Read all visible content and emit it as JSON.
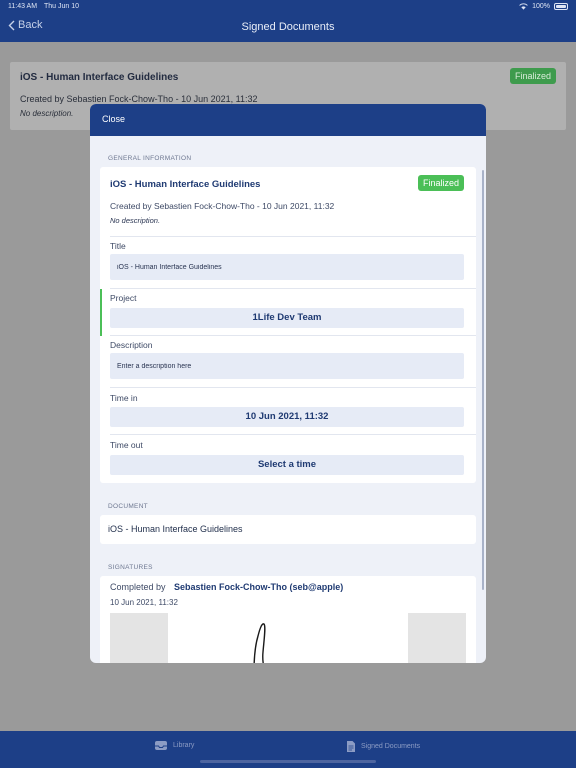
{
  "status_bar": {
    "time": "11:43 AM",
    "date": "Thu Jun 10",
    "battery": "100%"
  },
  "nav": {
    "back_label": "Back",
    "title": "Signed Documents"
  },
  "background_row": {
    "title": "iOS - Human Interface Guidelines",
    "status": "Finalized",
    "meta": "Created by Sebastien Fock-Chow-Tho - 10 Jun 2021, 11:32",
    "description": "No description."
  },
  "modal": {
    "close_label": "Close",
    "general": {
      "section_label": "GENERAL INFORMATION",
      "title": "iOS - Human Interface Guidelines",
      "status": "Finalized",
      "meta": "Created by Sebastien Fock-Chow-Tho - 10 Jun 2021, 11:32",
      "description": "No description.",
      "fields": {
        "title_label": "Title",
        "title_value": "iOS - Human Interface Guidelines",
        "project_label": "Project",
        "project_value": "1Life Dev Team",
        "description_label": "Description",
        "description_placeholder": "Enter a description here",
        "time_in_label": "Time in",
        "time_in_value": "10 Jun 2021, 11:32",
        "time_out_label": "Time out",
        "time_out_value": "Select a time"
      }
    },
    "document": {
      "section_label": "DOCUMENT",
      "name": "iOS - Human Interface Guidelines"
    },
    "signatures": {
      "section_label": "SIGNATURES",
      "completed_by_label": "Completed by",
      "signer": "Sebastien Fock-Chow-Tho (seb@apple)",
      "date": "10 Jun 2021, 11:32"
    }
  },
  "tabbar": {
    "items": [
      {
        "label": "Library",
        "icon": "tray-icon"
      },
      {
        "label": "Signed Documents",
        "icon": "document-icon"
      }
    ]
  },
  "colors": {
    "nav_blue": "#1d3f87",
    "finalized_green": "#4bbf57",
    "modal_bg": "#eef1f8",
    "field_bg": "#e6ebf6"
  }
}
